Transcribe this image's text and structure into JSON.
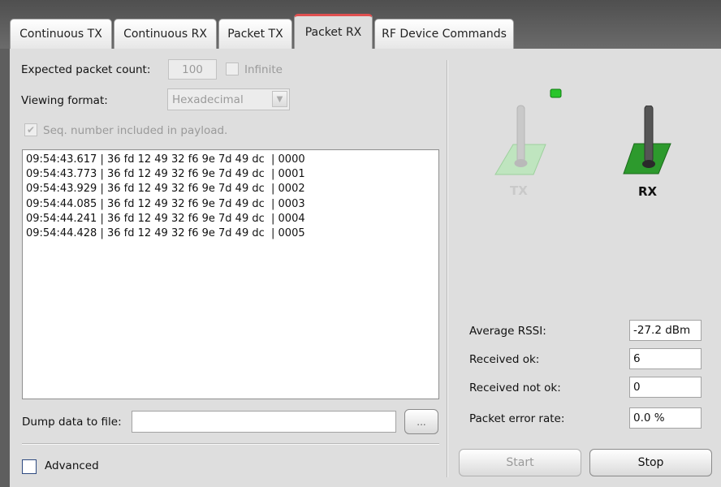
{
  "tabs": [
    {
      "label": "Continuous TX"
    },
    {
      "label": "Continuous RX"
    },
    {
      "label": "Packet TX"
    },
    {
      "label": "Packet RX"
    },
    {
      "label": "RF Device Commands"
    }
  ],
  "active_tab": "Packet RX",
  "settings": {
    "expected_count_label": "Expected packet count:",
    "expected_count_value": "100",
    "infinite_label": "Infinite",
    "viewing_format_label": "Viewing format:",
    "viewing_format_value": "Hexadecimal",
    "seq_label": "Seq. number included in payload.",
    "seq_check": "✔"
  },
  "log": [
    "09:54:43.617 | 36 fd 12 49 32 f6 9e 7d 49 dc  | 0000",
    "09:54:43.773 | 36 fd 12 49 32 f6 9e 7d 49 dc  | 0001",
    "09:54:43.929 | 36 fd 12 49 32 f6 9e 7d 49 dc  | 0002",
    "09:54:44.085 | 36 fd 12 49 32 f6 9e 7d 49 dc  | 0003",
    "09:54:44.241 | 36 fd 12 49 32 f6 9e 7d 49 dc  | 0004",
    "09:54:44.428 | 36 fd 12 49 32 f6 9e 7d 49 dc  | 0005"
  ],
  "dump": {
    "label": "Dump data to file:",
    "value": "",
    "browse_label": "..."
  },
  "advanced_label": "Advanced",
  "radio": {
    "tx_label": "TX",
    "rx_label": "RX",
    "tx_led_color": "#29c52b",
    "rx_color": "#2d9a2d"
  },
  "stats": {
    "rssi_label": "Average RSSI:",
    "rssi_value": "-27.2 dBm",
    "ok_label": "Received ok:",
    "ok_value": "6",
    "notok_label": "Received not ok:",
    "notok_value": "0",
    "per_label": "Packet error rate:",
    "per_value": "0.0 %"
  },
  "buttons": {
    "start": "Start",
    "stop": "Stop"
  }
}
